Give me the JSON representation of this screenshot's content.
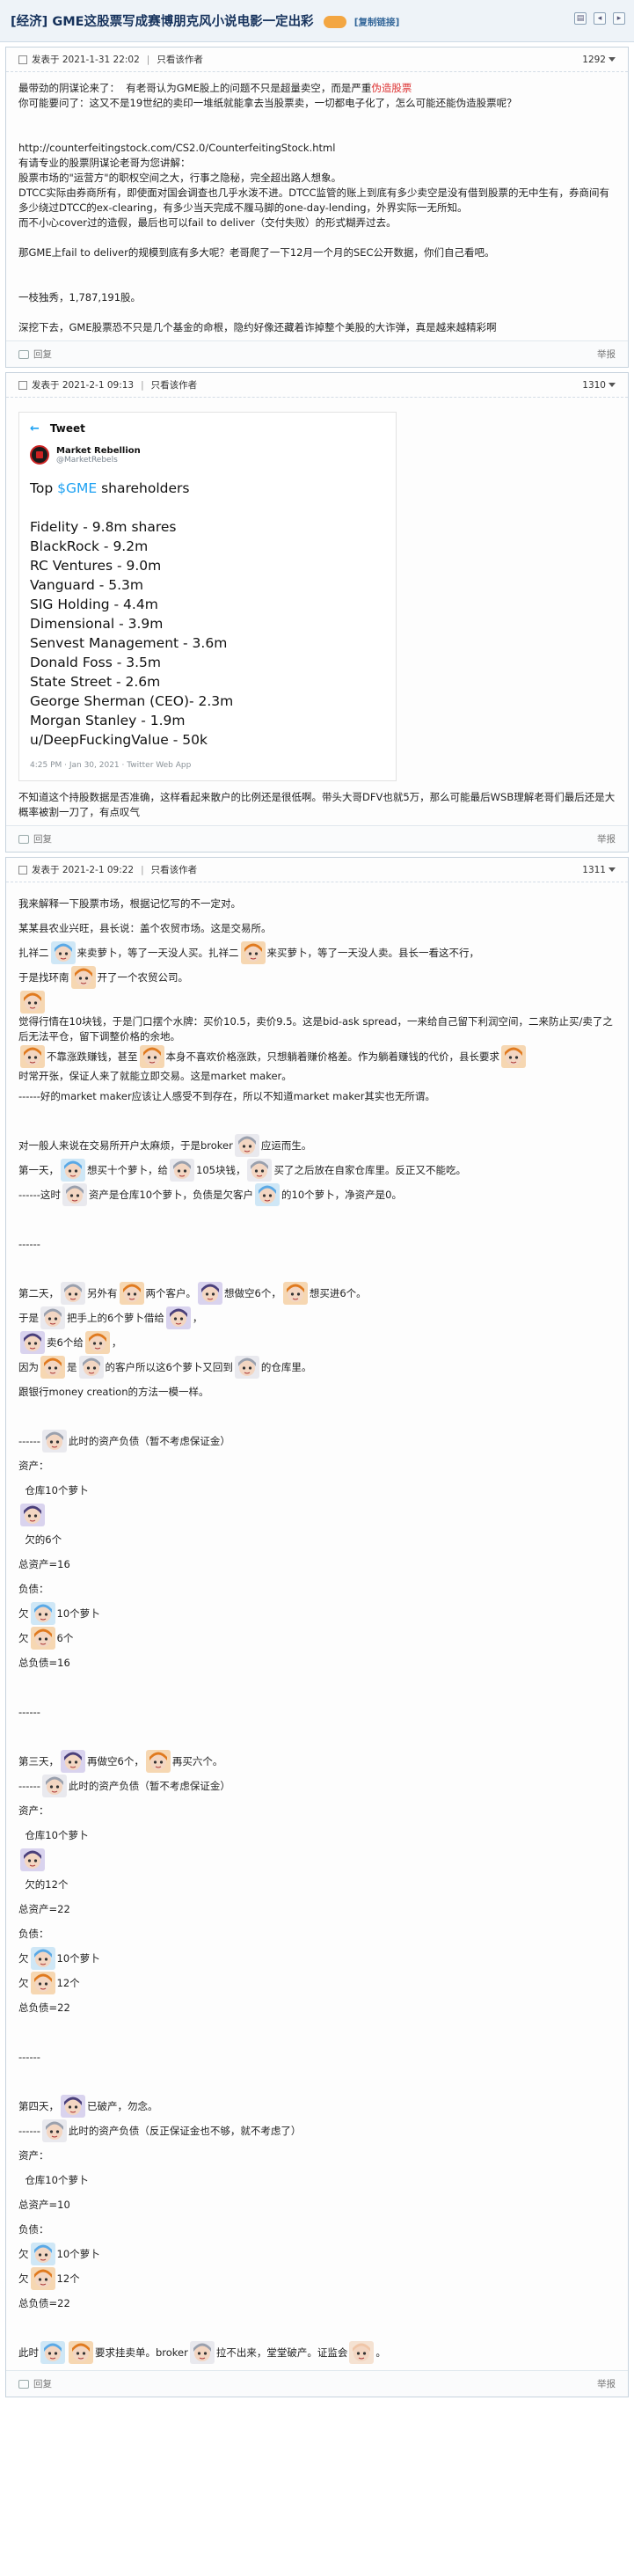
{
  "thread": {
    "category": "[经济]",
    "title": "GME这股票写成赛博朋克风小说电影一定出彩",
    "copy_link": "[复制链接]"
  },
  "posts": [
    {
      "date": "发表于 2021-1-31 22:02",
      "filter": "只看该作者",
      "floor": "1292",
      "lines": [
        "最带劲的阴谋论来了：  有老哥认为GME股上的问题不只是超量卖空，而是严重",
        "你可能要问了：这又不是19世纪的卖印一堆纸就能拿去当股票卖，一切都电子化了，怎么可能还能伪造股票呢？",
        "",
        "",
        "http://counterfeitingstock.com/CS2.0/CounterfeitingStock.html",
        "有请专业的股票阴谋论老哥为您讲解：",
        "股票市场的\"运营方\"的职权空间之大，行事之隐秘，完全超出路人想象。",
        "DTCC实际由券商所有，即使面对国会调查也几乎水泼不进。DTCC监管的账上到底有多少卖空是没有借到股票的无中生有，券商间有多少绕过DTCC的ex-clearing，有多少当天完成不履马脚的one-day-lending，外界实际一无所知。",
        "而不小心cover过的造假，最后也可以fail to deliver（交付失败）的形式糊弄过去。",
        "",
        "那GME上fail to deliver的规模到底有多大呢？老哥爬了一下12月一个月的SEC公开数据，你们自己看吧。",
        "",
        "",
        "一枝独秀，1,787,191股。",
        "",
        "深挖下去，GME股票恐不只是几个基金的命根，隐约好像还藏着诈掉整个美股的大诈弹，真是越来越精彩啊"
      ],
      "highlight": "伪造股票",
      "reply": "回复",
      "report": "举报"
    },
    {
      "date": "发表于 2021-2-1 09:13",
      "filter": "只看该作者",
      "floor": "1310",
      "tweet": {
        "header": "Tweet",
        "name": "Market Rebellion",
        "handle": "@MarketRebels",
        "top_prefix": "Top ",
        "ticker": "$GME",
        "top_suffix": " shareholders",
        "holders": [
          "Fidelity - 9.8m shares",
          "BlackRock - 9.2m",
          "RC Ventures - 9.0m",
          "Vanguard - 5.3m",
          "SIG Holding - 4.4m",
          "Dimensional - 3.9m",
          "Senvest Management - 3.6m",
          "Donald Foss - 3.5m",
          "State Street - 2.6m",
          "George Sherman (CEO)- 2.3m",
          "Morgan Stanley - 1.9m",
          "u/DeepFuckingValue - 50k"
        ],
        "meta": "4:25 PM · Jan 30, 2021 · Twitter Web App"
      },
      "lines": [
        "不知道这个持股数据是否准确，这样看起来散户的比例还是很低啊。带头大哥DFV也就5万，那么可能最后WSB理解老哥们最后还是大概率被割一刀了，有点叹气"
      ],
      "reply": "回复",
      "report": "举报"
    },
    {
      "date": "发表于 2021-2-1 09:22",
      "filter": "只看该作者",
      "floor": "1311",
      "reply": "回复",
      "report": "举报",
      "lines": [
        [
          "我来解释一下股票市场，根据记忆写的不一定对。"
        ],
        [
          "某某县农业兴旺，县长说：盖个农贸市场。这是交易所。"
        ],
        [
          "扎祥二",
          "@c",
          "来卖萝卜，等了一天没人买。扎祥二",
          "@o",
          "来买萝卜，等了一天没人卖。县长一看这不行，"
        ],
        [
          "于是找环南",
          "@o",
          "开了一个农贸公司。"
        ],
        [
          "",
          "@o",
          "觉得行情在10块钱，于是门口摆个水牌：买价10.5，卖价9.5。这是bid-ask spread，一来给自己留下利润空间，二来防止买/卖了之后无法平仓，留下调整价格的余地。"
        ],
        [
          "",
          "@o",
          "不靠涨跌赚钱，甚至",
          "@o",
          "本身不喜欢价格涨跌，只想躺着赚价格差。作为躺着赚钱的代价，县长要求",
          "@o",
          "时常开张，保证人来了就能立即交易。这是market maker。"
        ],
        [
          "------好的market maker应该让人感受不到存在，所以不知道market maker其实也无所谓。"
        ],
        [
          ""
        ],
        [
          "对一般人来说在交易所开户太麻烦，于是broker",
          "@g",
          "应运而生。"
        ],
        [
          "第一天，",
          "@c",
          "想买十个萝卜，给",
          "@g",
          "105块钱，",
          "@g",
          "买了之后放在自家仓库里。反正又不能吃。"
        ],
        [
          "------这时",
          "@g",
          "资产是仓库10个萝卜，负债是欠客户",
          "@c",
          "的10个萝卜，净资产是0。"
        ],
        [
          ""
        ],
        [
          "------"
        ],
        [
          ""
        ],
        [
          "第二天，",
          "@g",
          "另外有",
          "@o",
          "两个客户。",
          "@p",
          "想做空6个，",
          "@o",
          "想买进6个。"
        ],
        [
          "于是",
          "@g",
          "把手上的6个萝卜借给",
          "@p",
          "，"
        ],
        [
          "",
          "@p",
          "卖6个给",
          "@o",
          "，"
        ],
        [
          "因为",
          "@o",
          "是",
          "@g",
          "的客户所以这6个萝卜又回到",
          "@g",
          "的仓库里。"
        ],
        [
          "跟银行money creation的方法一模一样。"
        ],
        [
          ""
        ],
        [
          "------",
          "@g",
          "此时的资产负债（暂不考虑保证金）"
        ],
        [
          "资产："
        ],
        [
          "  仓库10个萝卜"
        ],
        [
          "",
          "@p",
          ""
        ],
        [
          "  欠的6个"
        ],
        [
          "总资产=16"
        ],
        [
          "负债："
        ],
        [
          "欠",
          "@c",
          "10个萝卜"
        ],
        [
          "欠",
          "@o",
          "6个"
        ],
        [
          "总负债=16"
        ],
        [
          ""
        ],
        [
          "------"
        ],
        [
          ""
        ],
        [
          "第三天，",
          "@p",
          "再做空6个，",
          "@o",
          "再买六个。"
        ],
        [
          "------",
          "@g",
          "此时的资产负债（暂不考虑保证金）"
        ],
        [
          "资产："
        ],
        [
          "  仓库10个萝卜"
        ],
        [
          "",
          "@p",
          ""
        ],
        [
          "  欠的12个"
        ],
        [
          "总资产=22"
        ],
        [
          "负债："
        ],
        [
          "欠",
          "@c",
          "10个萝卜"
        ],
        [
          "欠",
          "@o",
          "12个"
        ],
        [
          "总负债=22"
        ],
        [
          ""
        ],
        [
          "------"
        ],
        [
          ""
        ],
        [
          "第四天，",
          "@p",
          "已破产，勿念。"
        ],
        [
          "------",
          "@g",
          "此时的资产负债（反正保证金也不够，就不考虑了）"
        ],
        [
          "资产："
        ],
        [
          "  仓库10个萝卜"
        ],
        [
          "总资产=10"
        ],
        [
          "负债："
        ],
        [
          "欠",
          "@c",
          "10个萝卜"
        ],
        [
          "欠",
          "@o",
          "12个"
        ],
        [
          "总负债=22"
        ],
        [
          ""
        ],
        [
          "此时",
          "@c",
          "",
          "@o",
          "要求挂卖单。broker",
          "@g",
          "拉不出来，堂堂破产。证监会",
          "@x",
          "。"
        ]
      ]
    }
  ],
  "colors": {
    "title": "#16325c",
    "link": "#336699",
    "highlight": "#dd3333",
    "twitter_blue": "#1da1f2"
  },
  "emoticons": {
    "@c": "cyan-hair-character",
    "@o": "orange-hair-character",
    "@p": "purple-hair-character",
    "@g": "gray-hair-character",
    "@x": "bald-character"
  }
}
